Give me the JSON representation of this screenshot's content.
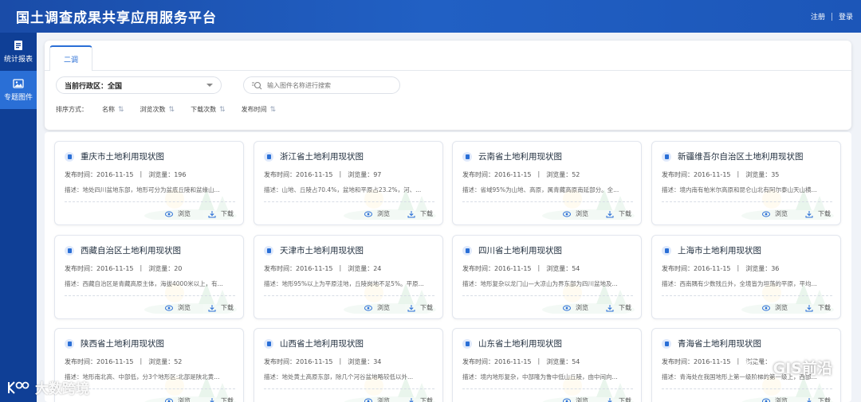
{
  "header": {
    "title": "国土调查成果共享应用服务平台",
    "register": "注册",
    "login": "登录"
  },
  "sidebar": {
    "items": [
      {
        "label": "统计报表",
        "icon": "report-icon"
      },
      {
        "label": "专题图件",
        "icon": "image-icon"
      }
    ]
  },
  "tabs": [
    {
      "label": "二调"
    }
  ],
  "filters": {
    "region": "当前行政区：全国",
    "search_placeholder": "输入图件名称进行搜索",
    "sort_label": "排序方式：",
    "sort_options": [
      "名称",
      "浏览次数",
      "下载次数",
      "发布时间"
    ]
  },
  "card_labels": {
    "date_prefix": "发布时间：",
    "views_prefix": "浏览量：",
    "browse": "浏览",
    "download": "下载"
  },
  "cards": [
    {
      "title": "重庆市土地利用现状图",
      "date": "2016-11-15",
      "views": "196",
      "desc": "描述：地处四川盆地东部，地形可分为盆底丘陵和盆缘山..."
    },
    {
      "title": "浙江省土地利用现状图",
      "date": "2016-11-15",
      "views": "97",
      "desc": "描述：山地、丘陵占70.4%，盆地和平原占23.2%，河、..."
    },
    {
      "title": "云南省土地利用现状图",
      "date": "2016-11-15",
      "views": "52",
      "desc": "描述：省域95%为山地、高原，属青藏高原南延部分。全..."
    },
    {
      "title": "新疆维吾尔自治区土地利用现状图",
      "date": "2016-11-15",
      "views": "35",
      "desc": "描述：境内南有帕米尔高原和昆仑山北有阿尔泰山天山横..."
    },
    {
      "title": "西藏自治区土地利用现状图",
      "date": "2016-11-15",
      "views": "20",
      "desc": "描述：西藏自治区是青藏高原主体，海拔4000米以上，有..."
    },
    {
      "title": "天津市土地利用现状图",
      "date": "2016-11-15",
      "views": "24",
      "desc": "描述：地形95%以上为平原洼地，丘陵岗地不足5%。平原..."
    },
    {
      "title": "四川省土地利用现状图",
      "date": "2016-11-15",
      "views": "54",
      "desc": "描述：地形复杂以龙门山—大凉山为界东部为四川盆地及..."
    },
    {
      "title": "上海市土地利用现状图",
      "date": "2016-11-15",
      "views": "36",
      "desc": "描述：西南隅有少数残丘外，全境皆为坦荡的平原，平均..."
    },
    {
      "title": "陕西省土地利用现状图",
      "date": "2016-11-15",
      "views": "52",
      "desc": "描述：地形南北高、中部低，分3个地形区:北部是陕北黄..."
    },
    {
      "title": "山西省土地利用现状图",
      "date": "2016-11-15",
      "views": "34",
      "desc": "描述：地处黄土高原东部，除几个河谷盆地略较低以外..."
    },
    {
      "title": "山东省土地利用现状图",
      "date": "2016-11-15",
      "views": "54",
      "desc": "描述：境内地形复杂，中部隆为鲁中低山丘陵，由中间向..."
    },
    {
      "title": "青海省土地利用现状图",
      "date": "2016-11-15",
      "views": "",
      "desc": "描述：青海处在我国地形上第一级阶梯的第一级上，西部..."
    }
  ],
  "watermarks": {
    "left": "大数跨境",
    "right": "GIS前沿"
  }
}
